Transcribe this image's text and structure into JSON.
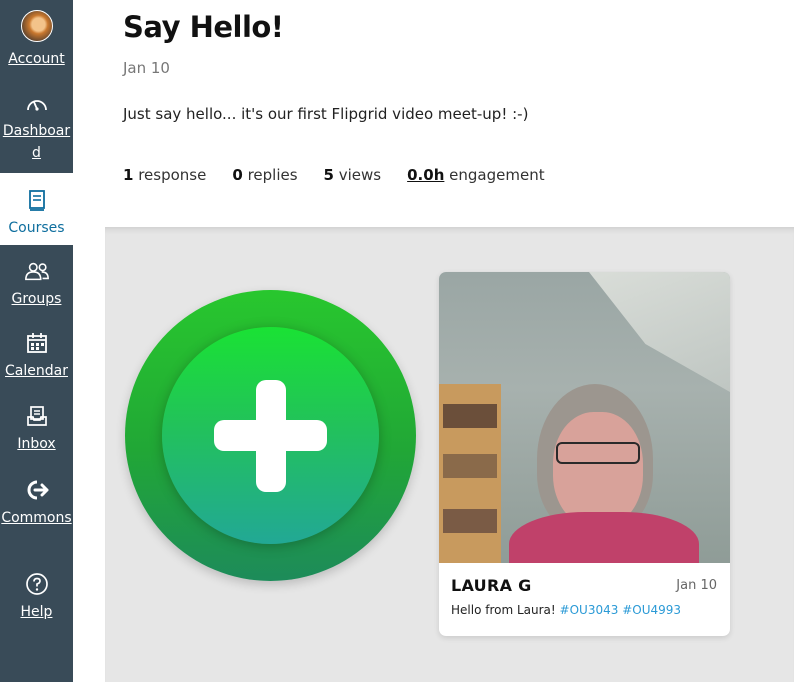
{
  "sidebar": {
    "items": [
      {
        "label": "Account",
        "icon": "avatar"
      },
      {
        "label": "Dashboard",
        "icon": "dashboard-gauge-icon"
      },
      {
        "label": "Courses",
        "icon": "book-icon",
        "active": true
      },
      {
        "label": "Groups",
        "icon": "users-icon"
      },
      {
        "label": "Calendar",
        "icon": "calendar-icon"
      },
      {
        "label": "Inbox",
        "icon": "inbox-icon"
      },
      {
        "label": "Commons",
        "icon": "commons-arrow-icon"
      },
      {
        "label": "Help",
        "icon": "help-icon"
      }
    ]
  },
  "post": {
    "title": "Say Hello!",
    "date": "Jan 10",
    "description": "Just say hello... it's our first Flipgrid video meet-up! :-)",
    "stats": {
      "responses_count": "1",
      "responses_label": "response",
      "replies_count": "0",
      "replies_label": "replies",
      "views_count": "5",
      "views_label": "views",
      "engagement_value": "0.0h",
      "engagement_label": "engagement"
    }
  },
  "responses": [
    {
      "name": "LAURA G",
      "date": "Jan 10",
      "caption": "Hello from Laura!",
      "tags": [
        "#OU3043",
        "#OU4993"
      ]
    }
  ],
  "colors": {
    "sidebar_bg": "#394b58",
    "active_text": "#0e6e9e",
    "add_button_green": "#21a736",
    "tag_blue": "#2b9ad6",
    "content_bg": "#e6e6e6"
  }
}
